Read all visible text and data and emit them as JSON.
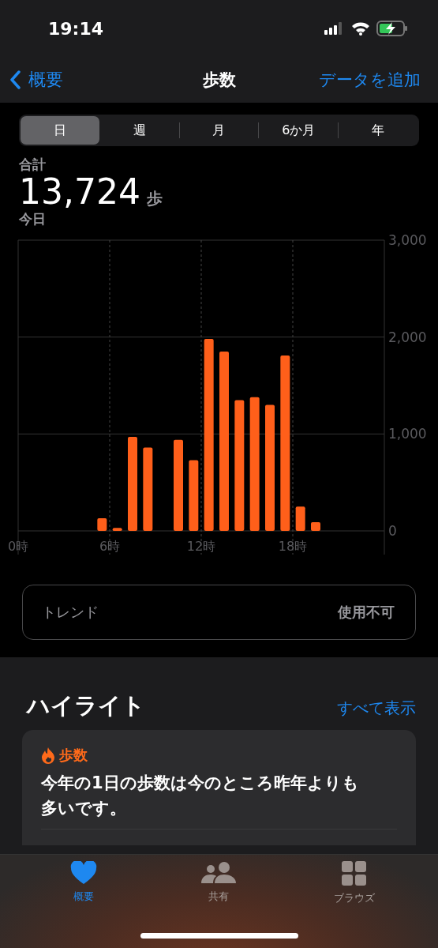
{
  "status_bar": {
    "time": "19:14"
  },
  "nav": {
    "back": "概要",
    "title": "歩数",
    "action": "データを追加"
  },
  "ranges": [
    {
      "label": "日",
      "selected": true
    },
    {
      "label": "週",
      "selected": false
    },
    {
      "label": "月",
      "selected": false
    },
    {
      "label": "6か月",
      "selected": false
    },
    {
      "label": "年",
      "selected": false
    }
  ],
  "summary": {
    "label": "合計",
    "value": "13,724",
    "unit": "歩",
    "period": "今日"
  },
  "chart_data": {
    "type": "bar",
    "x": [
      5.5,
      6.5,
      7.5,
      8.5,
      10.5,
      11.5,
      12.5,
      13.5,
      14.5,
      15.5,
      16.5,
      17.5,
      18.5,
      19.5
    ],
    "xlim": [
      0,
      24
    ],
    "grid": true,
    "values": [
      130,
      30,
      970,
      860,
      940,
      730,
      1980,
      1850,
      1350,
      1380,
      1300,
      1810,
      250,
      90
    ],
    "ylim": [
      0,
      3000
    ],
    "xticks": [
      {
        "value": 0,
        "label": "0時"
      },
      {
        "value": 6,
        "label": "6時"
      },
      {
        "value": 12,
        "label": "12時"
      },
      {
        "value": 18,
        "label": "18時"
      }
    ],
    "yticks": [
      {
        "value": 0,
        "label": "0"
      },
      {
        "value": 1000,
        "label": "1,000"
      },
      {
        "value": 2000,
        "label": "2,000"
      },
      {
        "value": 3000,
        "label": "3,000"
      }
    ]
  },
  "trend": {
    "label": "トレンド",
    "value": "使用不可"
  },
  "highlights": {
    "title": "ハイライト",
    "link": "すべて表示",
    "card": {
      "category": "歩数",
      "text": "今年の1日の歩数は今のところ昨年よりも多いです。"
    }
  },
  "tab_bar": [
    {
      "label": "概要",
      "kind": "heart",
      "selected": true
    },
    {
      "label": "共有",
      "kind": "people",
      "selected": false
    },
    {
      "label": "ブラウズ",
      "kind": "grid",
      "selected": false
    }
  ]
}
